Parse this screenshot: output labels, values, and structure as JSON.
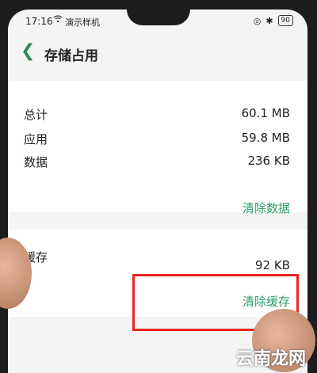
{
  "status_bar": {
    "time": "17:16",
    "carrier": "演示样机",
    "battery": "90"
  },
  "header": {
    "title": "存储占用"
  },
  "storage": {
    "rows": [
      {
        "label": "总计",
        "value": "60.1 MB"
      },
      {
        "label": "应用",
        "value": "59.8 MB"
      },
      {
        "label": "数据",
        "value": "236 KB"
      }
    ],
    "clear_data_label": "清除数据"
  },
  "cache": {
    "label": "缓存",
    "value": "92 KB",
    "clear_cache_label": "清除缓存"
  },
  "watermark": "云南龙网",
  "colors": {
    "accent": "#2e9e6a",
    "highlight": "#e8251f"
  }
}
